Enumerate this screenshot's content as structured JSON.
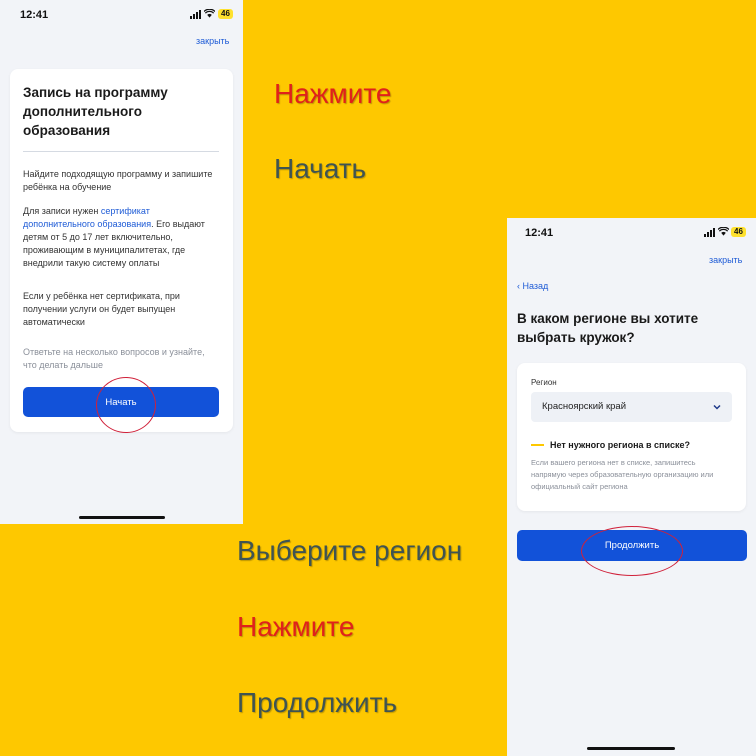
{
  "colors": {
    "background": "#FEC800",
    "accent_blue": "#1252D9",
    "caption_red": "#E0211B",
    "caption_gray": "#3F5452",
    "circle": "#D0213A"
  },
  "icons": {
    "signal": "signal-bars-icon",
    "wifi": "wifi-icon",
    "battery": "battery-icon",
    "back": "chevron-left-icon",
    "dropdown": "chevron-down-icon"
  },
  "left_screen": {
    "status": {
      "time": "12:41",
      "battery": "46"
    },
    "close": "закрыть",
    "title": "Запись на программу дополнительного образования",
    "p1": "Найдите подходящую программу и запишите ребёнка на обучение",
    "p2_pre": "Для записи нужен ",
    "p2_link": "сертификат дополнительного образования",
    "p2_post": ". Его выдают детям от 5 до 17 лет включительно, проживающим в муниципалитетах, где внедрили такую систему оплаты",
    "p3": "Если у ребёнка нет сертификата, при получении услуги он будет выпущен автоматически",
    "p4": "Ответьте на несколько вопросов и узнайте, что делать дальше",
    "button": "Начать"
  },
  "right_screen": {
    "status": {
      "time": "12:41",
      "battery": "46"
    },
    "close": "закрыть",
    "back": "Назад",
    "title": "В каком регионе вы хотите выбрать кружок?",
    "region_label": "Регион",
    "region_value": "Красноярский край",
    "no_region_title": "Нет нужного региона в списке?",
    "no_region_text": "Если вашего региона нет в списке, запишитесь напрямую через образовательную организацию или официальный сайт региона",
    "button": "Продолжить"
  },
  "captions": {
    "c1": "Нажмите",
    "c2": "Начать",
    "c3": "Выберите регион",
    "c4": "Нажмите",
    "c5": "Продолжить"
  }
}
